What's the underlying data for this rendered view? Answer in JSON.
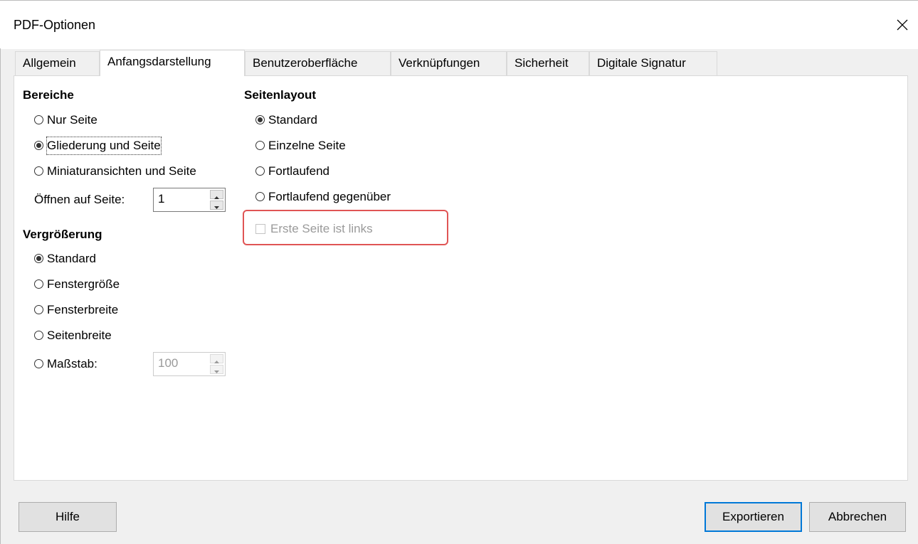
{
  "window": {
    "title": "PDF-Optionen",
    "close_icon": "close-icon"
  },
  "tabs": [
    {
      "label": "Allgemein",
      "active": false
    },
    {
      "label": "Anfangsdarstellung",
      "active": true
    },
    {
      "label": "Benutzeroberfläche",
      "active": false
    },
    {
      "label": "Verknüpfungen",
      "active": false
    },
    {
      "label": "Sicherheit",
      "active": false
    },
    {
      "label": "Digitale Signatur",
      "active": false
    }
  ],
  "bereiche": {
    "heading": "Bereiche",
    "options": [
      {
        "label": "Nur Seite",
        "selected": false
      },
      {
        "label": "Gliederung und Seite",
        "selected": true
      },
      {
        "label": "Miniaturansichten und Seite",
        "selected": false
      }
    ],
    "open_on_page_label": "Öffnen auf Seite:",
    "open_on_page_value": "1"
  },
  "vergroesserung": {
    "heading": "Vergrößerung",
    "options": [
      {
        "label": "Standard",
        "selected": true
      },
      {
        "label": "Fenstergröße",
        "selected": false
      },
      {
        "label": "Fensterbreite",
        "selected": false
      },
      {
        "label": "Seitenbreite",
        "selected": false
      },
      {
        "label": "Maßstab:",
        "selected": false
      }
    ],
    "zoom_value": "100"
  },
  "seitenlayout": {
    "heading": "Seitenlayout",
    "options": [
      {
        "label": "Standard",
        "selected": true
      },
      {
        "label": "Einzelne Seite",
        "selected": false
      },
      {
        "label": "Fortlaufend",
        "selected": false
      },
      {
        "label": "Fortlaufend gegenüber",
        "selected": false
      }
    ],
    "first_page_left_label": "Erste Seite ist links",
    "first_page_left_checked": false,
    "first_page_left_enabled": false
  },
  "buttons": {
    "help": "Hilfe",
    "export": "Exportieren",
    "cancel": "Abbrechen"
  },
  "colors": {
    "highlight_border": "#e05555",
    "default_button_border": "#0078d7",
    "disabled_text": "#9a9a9a"
  }
}
